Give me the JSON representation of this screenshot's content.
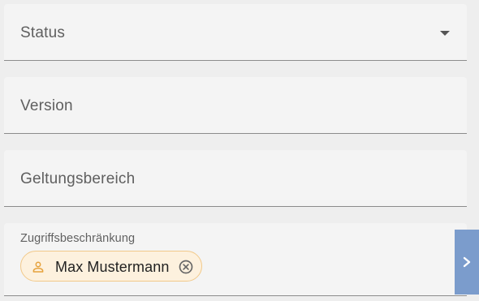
{
  "form": {
    "status": {
      "label": "Status",
      "icon": "dropdown-arrow-icon"
    },
    "version": {
      "label": "Version"
    },
    "scope": {
      "label": "Geltungsbereich"
    },
    "access_restriction": {
      "label": "Zugriffsbeschränkung",
      "chips": [
        {
          "label": "Max Mustermann",
          "icon": "person-icon",
          "remove_icon": "close-circle-icon"
        }
      ]
    }
  },
  "side_panel": {
    "toggle_icon": "chevron-right-icon"
  },
  "colors": {
    "field_background": "#f4f4f4",
    "page_background": "#eeeeee",
    "chip_background": "#fdf1de",
    "chip_border": "#f2c98a",
    "chip_icon": "#e6a23c",
    "side_panel": "#7b9ccc"
  }
}
